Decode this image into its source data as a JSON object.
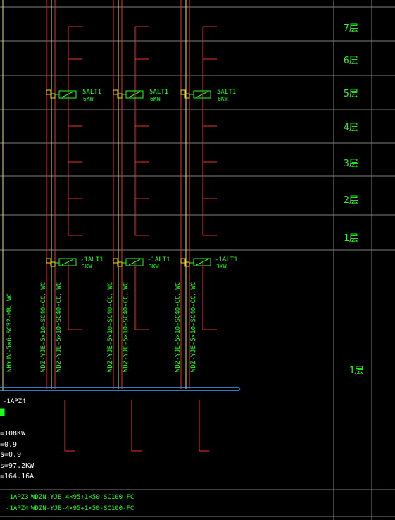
{
  "floors": [
    "7层",
    "6层",
    "5层",
    "4层",
    "3层",
    "2层",
    "1层",
    "-1层"
  ],
  "upper_panel": {
    "label": "5ALT1",
    "power": "6KW"
  },
  "lower_panel": {
    "label": "-1ALT1",
    "power": "3KW"
  },
  "risers": [
    {
      "cable_a": "WDZ-YJE-5×10-SC40-CC、WC",
      "cable_b": "WDZ-YJE-5×10-SC40-CC、WC"
    },
    {
      "cable_a": "WDZ-YJE-5×10-SC40-CC、WC",
      "cable_b": "WDZ-YJE-5×10-SC40-CC、WC"
    },
    {
      "cable_a": "WDZ-YJE-5×10-SC40-CC、WC",
      "cable_b": "WDZ-YJE-5×10-SC40-CC、WC"
    }
  ],
  "left_cable": "NHYJV-5×6-SC32-MR、WC",
  "distribution_box": "-1APZ4",
  "load_params": [
    "=108KW",
    "=0.9",
    "s=0.9",
    "s=97.2KW",
    "=164.16A"
  ],
  "feeders": [
    {
      "box": "-1APZ3",
      "cable": "WDZN-YJE-4×95+1×50-SC100-FC"
    },
    {
      "box": "-1APZ4",
      "cable": "WDZN-YJE-4×95+1×50-SC100-FC"
    }
  ],
  "colors": {
    "grid": "#808080",
    "riser_red": "#e83030",
    "riser_yellow": "#e8e060",
    "text_green": "#20ff20",
    "busbar_blue": "#40a0ff",
    "junction_yellow": "#ffd700"
  }
}
